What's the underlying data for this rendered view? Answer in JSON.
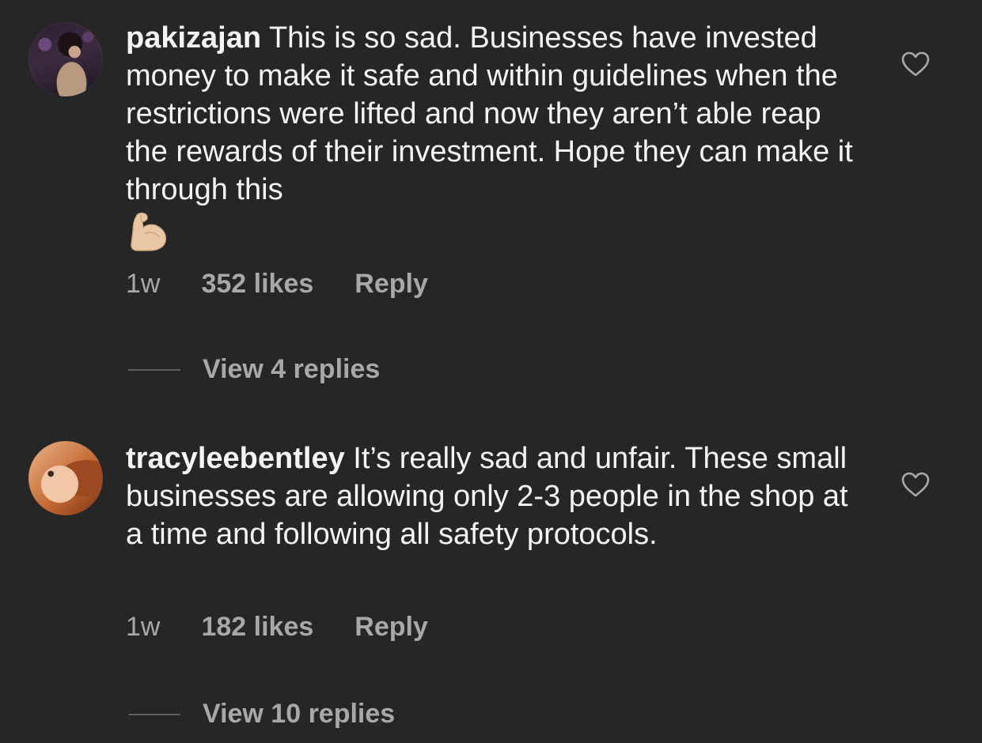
{
  "comments": [
    {
      "username": "pakizajan",
      "text": "This is so sad. Businesses have invested money to make it safe and within guidelines when the restrictions were lifted and now they aren’t able reap the rewards of their investment. Hope they can make it through this",
      "emoji": "flexed-biceps",
      "time": "1w",
      "likes": "352 likes",
      "reply": "Reply",
      "view_replies": "View 4 replies",
      "avatar_icon": "avatar-photo"
    },
    {
      "username": "tracyleebentley",
      "text": "It’s really sad and unfair. These small businesses are allowing only 2-3 people in the shop at a time and following all safety protocols.",
      "time": "1w",
      "likes": "182 likes",
      "reply": "Reply",
      "view_replies": "View 10 replies",
      "avatar_icon": "avatar-photo"
    }
  ],
  "icons": {
    "like": "heart-outline-icon"
  },
  "colors": {
    "background": "#262626",
    "primary_text": "#f5f5f5",
    "secondary_text": "#a8a8a8"
  }
}
